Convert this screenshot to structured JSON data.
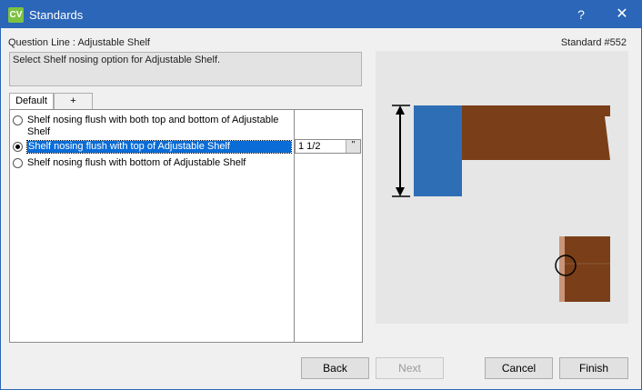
{
  "window": {
    "app_icon_text": "CV",
    "title": "Standards",
    "help_label": "?",
    "close_label": "✕"
  },
  "header": {
    "question_line": "Question Line : Adjustable Shelf",
    "standard_number": "Standard #552"
  },
  "description": "Select Shelf nosing option for Adjustable Shelf.",
  "tabs": [
    {
      "label": "Default",
      "active": true
    },
    {
      "label": "+",
      "active": false
    }
  ],
  "options": [
    {
      "label": "Shelf nosing flush with both top and bottom of Adjustable Shelf",
      "checked": false,
      "selected": false
    },
    {
      "label": "Shelf nosing flush with top of Adjustable Shelf",
      "checked": true,
      "selected": true
    },
    {
      "label": "Shelf nosing flush with bottom of Adjustable Shelf",
      "checked": false,
      "selected": false
    }
  ],
  "value_field": {
    "value": "1 1/2",
    "unit_button": "\""
  },
  "preview": {
    "colors": {
      "background": "#e6e6e6",
      "nosing": "#2e6eb5",
      "shelf": "#7a3f18",
      "edge": "#c8967a",
      "arrow": "#000000"
    }
  },
  "buttons": {
    "back": "Back",
    "next": "Next",
    "cancel": "Cancel",
    "finish": "Finish"
  }
}
